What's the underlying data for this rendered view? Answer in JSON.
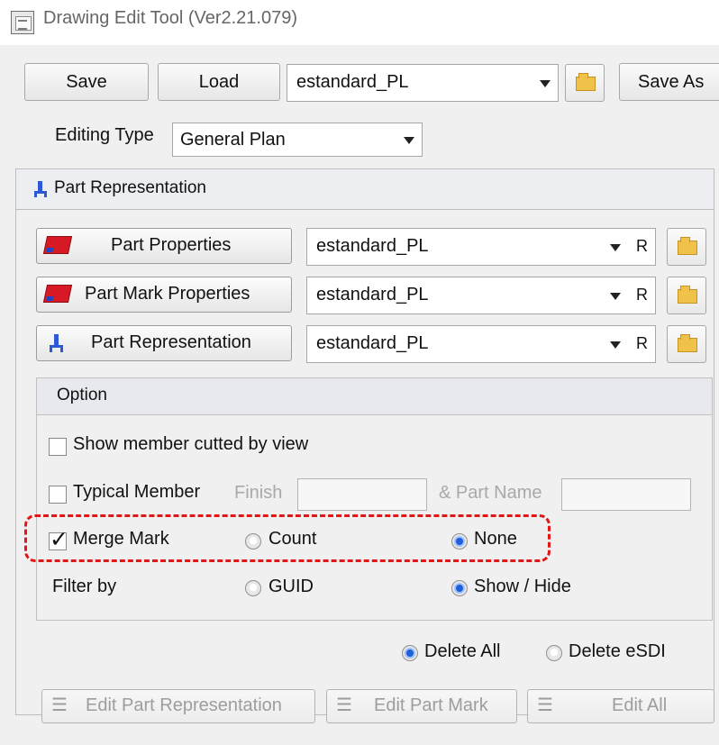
{
  "window": {
    "title": "Drawing Edit Tool (Ver2.21.079)"
  },
  "toolbar": {
    "save_label": "Save",
    "load_label": "Load",
    "preset_value": "estandard_PL",
    "save_as_label": "Save As"
  },
  "editing": {
    "label": "Editing Type",
    "value": "General Plan"
  },
  "section": {
    "title": "Part Representation"
  },
  "rows": [
    {
      "button_label": "Part Properties",
      "value": "estandard_PL",
      "flag": "R",
      "icon": "red-part-icon"
    },
    {
      "button_label": "Part Mark Properties",
      "value": "estandard_PL",
      "flag": "R",
      "icon": "red-part-icon"
    },
    {
      "button_label": "Part Representation",
      "value": "estandard_PL",
      "flag": "R",
      "icon": "blue-part-icon"
    }
  ],
  "option": {
    "title": "Option",
    "show_member": "Show member cutted by view",
    "typical_member": "Typical Member",
    "finish": "Finish",
    "part_name": "& Part Name",
    "merge_mark": "Merge Mark",
    "count": "Count",
    "none": "None",
    "filter_by": "Filter by",
    "guid": "GUID",
    "show_hide": "Show / Hide"
  },
  "delete": {
    "all": "Delete All",
    "esdi": "Delete eSDI"
  },
  "actions": {
    "edit_part_representation": "Edit Part Representation",
    "edit_part_mark": "Edit Part Mark",
    "edit_all": "Edit All"
  },
  "colors": {
    "highlight": "#e31616",
    "radio_selected": "#1f5fd8",
    "folder": "#f0c24a",
    "part_icon": "#d71926"
  }
}
